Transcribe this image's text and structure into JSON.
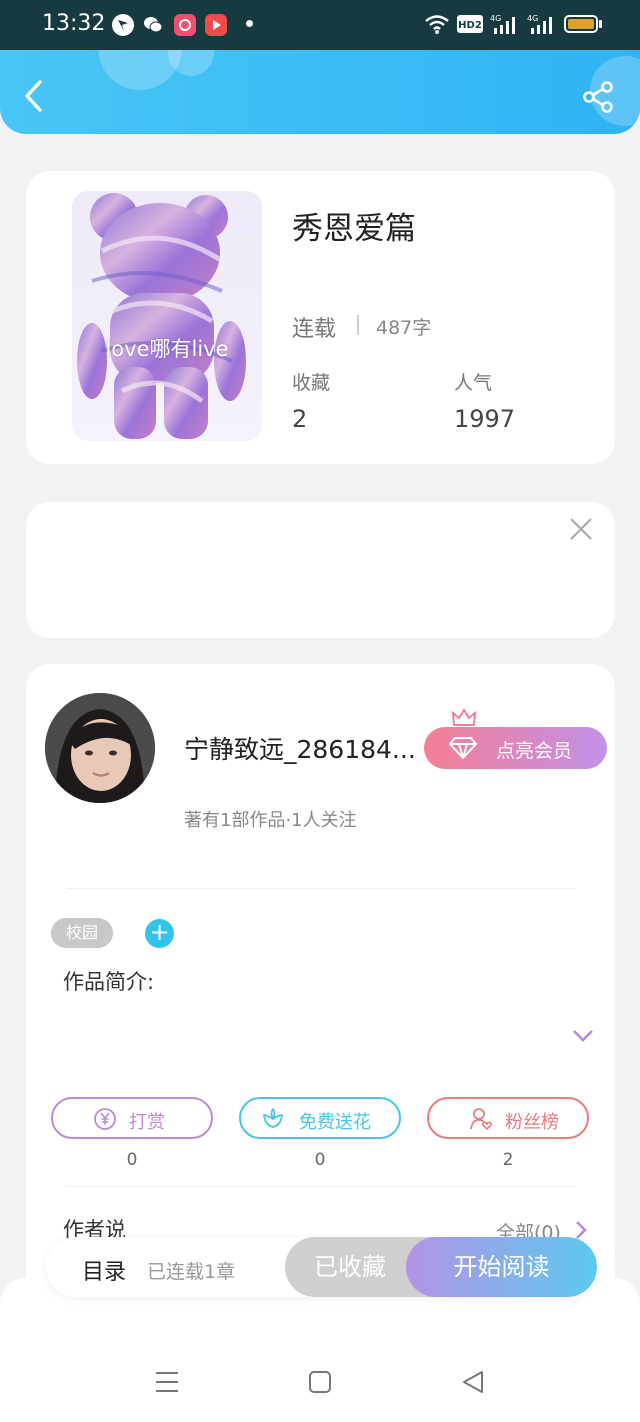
{
  "status_bar": {
    "time": "13:32",
    "network_1": "4G",
    "network_2": "4G",
    "hd_badge": "HD2",
    "battery_color": "#e0a030"
  },
  "header": {
    "back_icon": "chevron-left-icon",
    "share_icon": "share-icon",
    "gradient": [
      "#49c6f5",
      "#2fb3f3"
    ]
  },
  "book": {
    "title": "秀恩爱篇",
    "cover_text": "love哪有live",
    "status": "连载",
    "word_count": "487字",
    "favorites_label": "收藏",
    "favorites_value": "2",
    "popularity_label": "人气",
    "popularity_value": "1997"
  },
  "ad": {
    "close_icon": "close-icon"
  },
  "author": {
    "name": "宁静致远_286184...",
    "meta": "著有1部作品·1人关注",
    "vip_button": "点亮会员"
  },
  "tags": [
    "校园"
  ],
  "intro": {
    "label": "作品简介:"
  },
  "actions": [
    {
      "label": "打赏",
      "count": "0",
      "color": "#b98bd8",
      "icon": "yen-coin-icon"
    },
    {
      "label": "免费送花",
      "count": "0",
      "color": "#45c6e6",
      "icon": "flower-icon"
    },
    {
      "label": "粉丝榜",
      "count": "2",
      "color": "#ec7a7a",
      "icon": "user-heart-icon"
    }
  ],
  "author_says": {
    "label": "作者说",
    "all_link": "全部(0)"
  },
  "bottom_bar": {
    "toc_label": "目录",
    "toc_count": "已连载1章",
    "collected_label": "已收藏",
    "read_label": "开始阅读"
  },
  "system_nav": [
    "menu-icon",
    "home-square-icon",
    "back-triangle-icon"
  ]
}
